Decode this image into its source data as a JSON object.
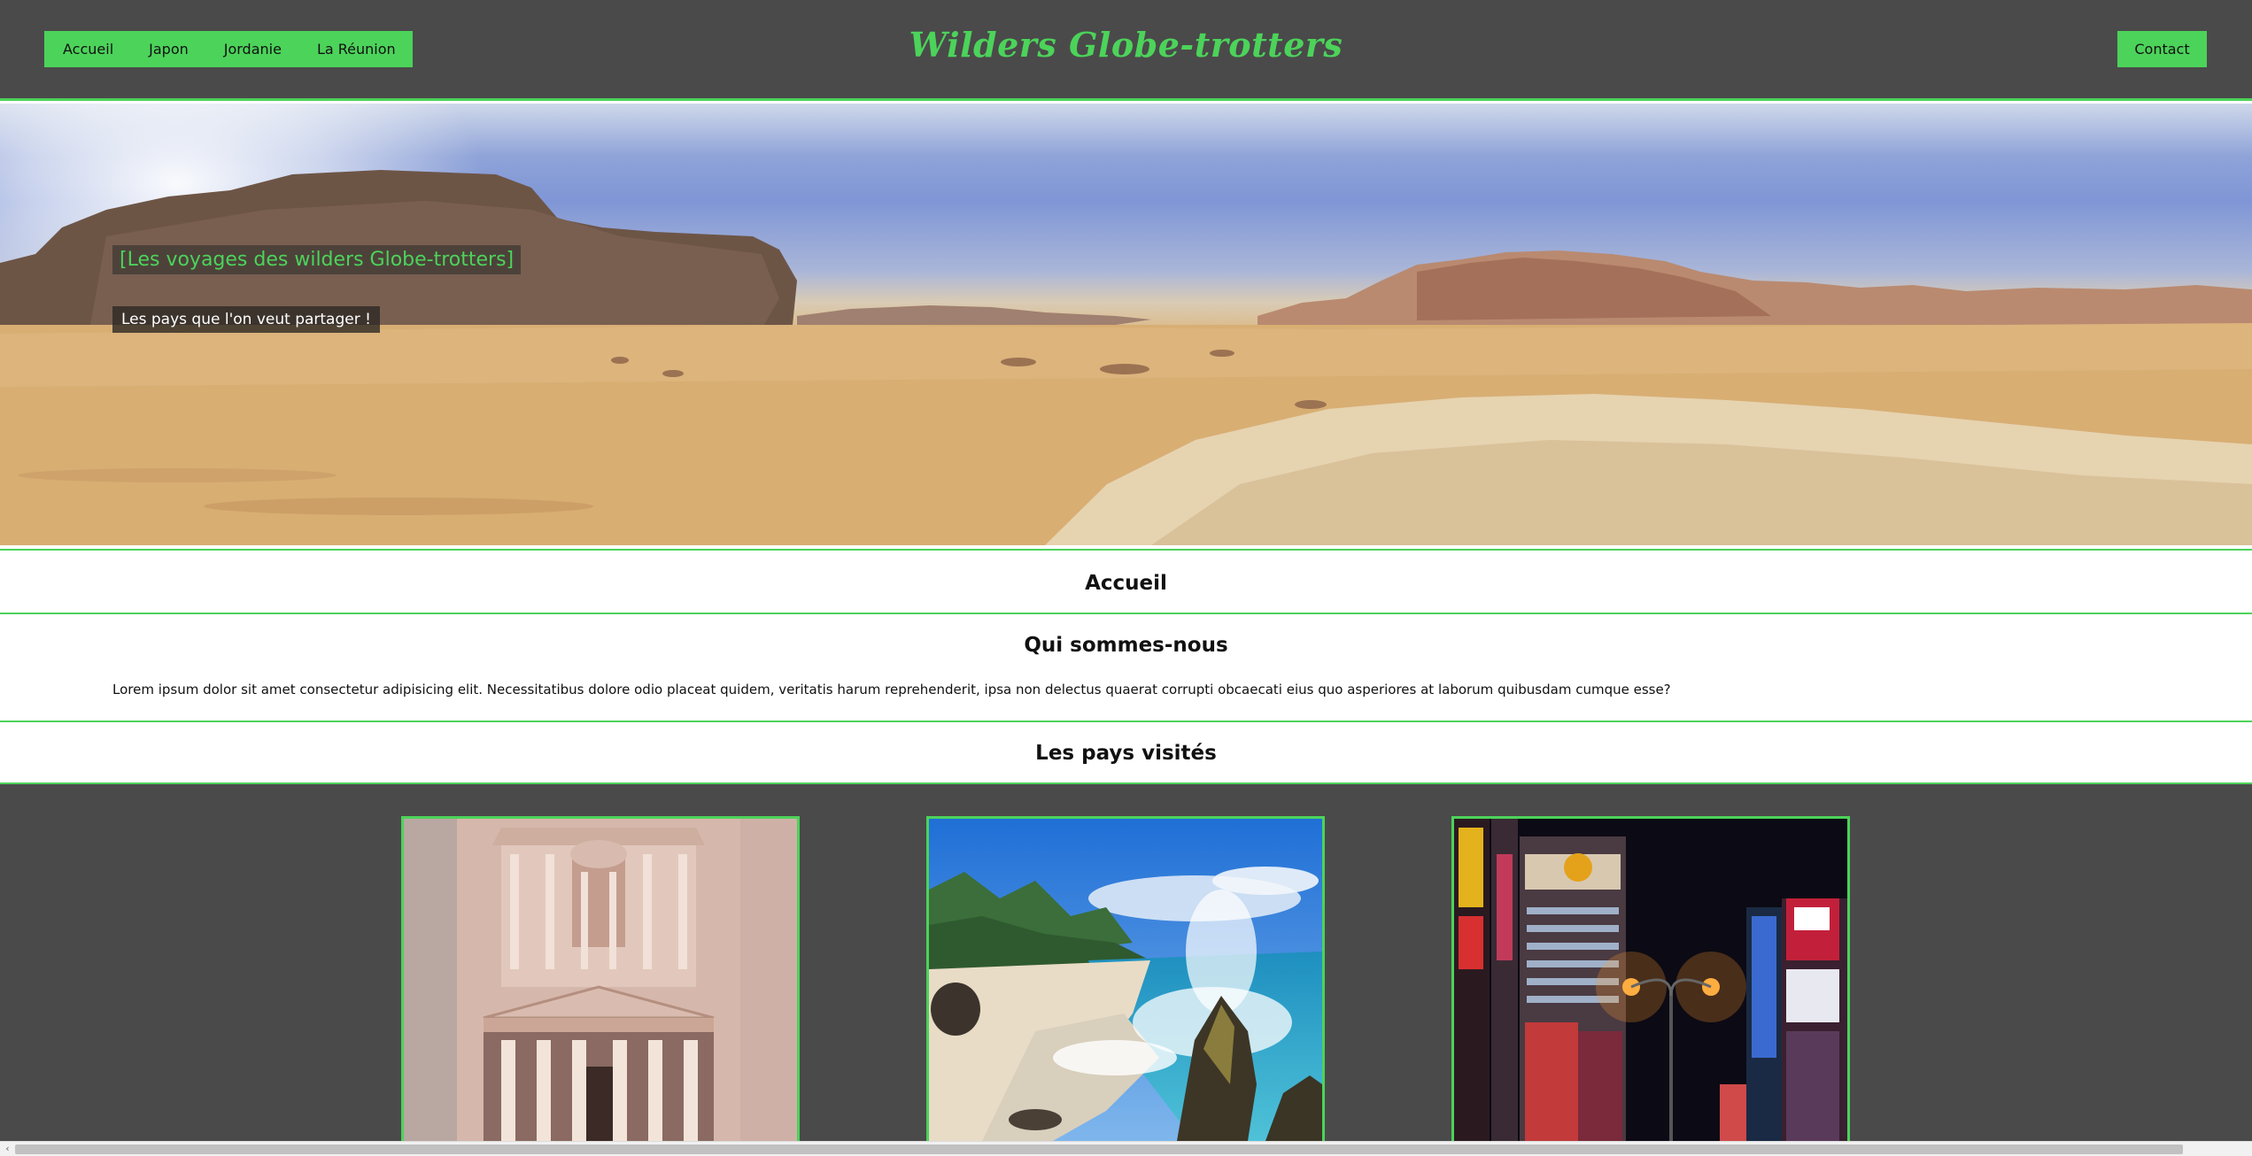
{
  "header": {
    "nav": [
      {
        "label": "Accueil"
      },
      {
        "label": "Japon"
      },
      {
        "label": "Jordanie"
      },
      {
        "label": "La Réunion"
      }
    ],
    "brand": "Wilders Globe-trotters",
    "contact_label": "Contact"
  },
  "hero": {
    "title": "[Les voyages des wilders Globe-trotters]",
    "subtitle": "Les pays que l'on veut partager !"
  },
  "sections": {
    "accueil": {
      "heading": "Accueil"
    },
    "about": {
      "heading": "Qui sommes-nous",
      "text": "Lorem ipsum dolor sit amet consectetur adipisicing elit. Necessitatibus dolore odio placeat quidem, veritatis harum reprehenderit, ipsa non delectus quaerat corrupti obcaecati eius quo asperiores at laborum quibusdam cumque esse?"
    },
    "countries": {
      "heading": "Les pays visités"
    }
  },
  "gallery": {
    "cards": [
      {
        "image": "petra-treasury"
      },
      {
        "image": "reunion-beach-waves"
      },
      {
        "image": "tokyo-night-street"
      }
    ]
  },
  "scrollbar": {
    "arrow": "‹"
  },
  "colors": {
    "accent": "#4cd35a",
    "header_bg": "#4a4a4a",
    "gallery_bg": "#4a4a4a",
    "section_bg": "#ffffff"
  }
}
